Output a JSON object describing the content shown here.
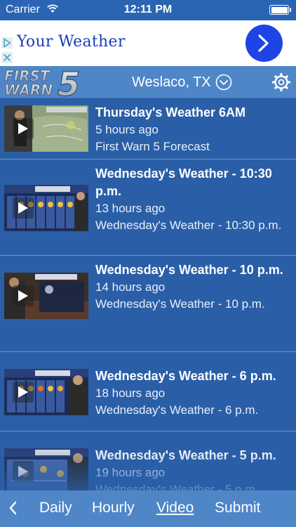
{
  "status_bar": {
    "carrier": "Carrier",
    "time": "12:11 PM"
  },
  "ad": {
    "title": "Your Weather"
  },
  "header": {
    "logo_line1": "FIRST",
    "logo_line2": "WARN",
    "logo_number": "5",
    "location": "Weslaco, TX"
  },
  "videos": [
    {
      "title": "Thursday's Weather 6AM",
      "ago": "5 hours ago",
      "desc": "First Warn 5 Forecast"
    },
    {
      "title": "Wednesday's Weather - 10:30 p.m.",
      "ago": "13 hours ago",
      "desc": "Wednesday's Weather - 10:30 p.m."
    },
    {
      "title": "Wednesday's Weather - 10 p.m.",
      "ago": "14 hours ago",
      "desc": "Wednesday's Weather - 10 p.m."
    },
    {
      "title": "Wednesday's Weather - 6 p.m.",
      "ago": "18 hours ago",
      "desc": "Wednesday's Weather - 6 p.m."
    },
    {
      "title": "Wednesday's Weather - 5 p.m.",
      "ago": "19 hours ago",
      "desc": "Wednesday's Weather - 5 p.m."
    }
  ],
  "bottom_nav": {
    "daily": "Daily",
    "hourly": "Hourly",
    "video": "Video",
    "submit": "Submit"
  }
}
